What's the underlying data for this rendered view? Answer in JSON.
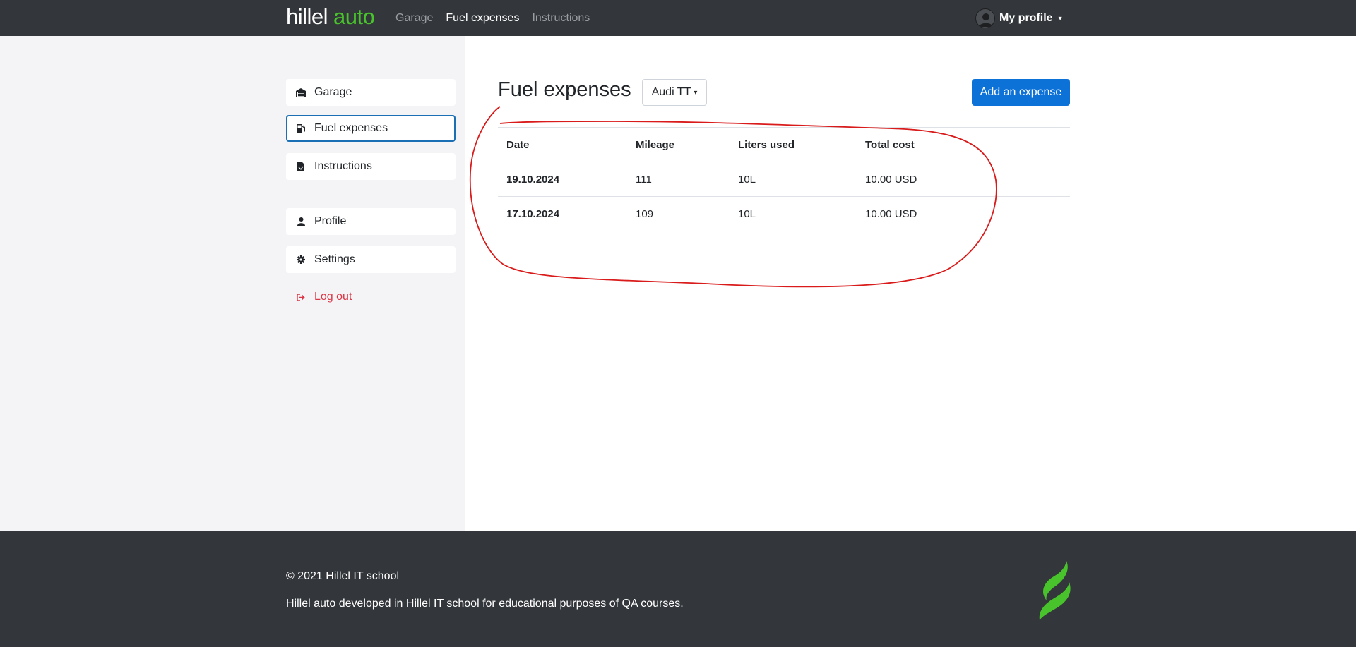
{
  "header": {
    "logo_primary": "hillel",
    "logo_secondary": "auto",
    "nav": [
      {
        "label": "Garage",
        "active": false
      },
      {
        "label": "Fuel expenses",
        "active": true
      },
      {
        "label": "Instructions",
        "active": false
      }
    ],
    "profile_label": "My profile"
  },
  "sidebar": {
    "items": [
      {
        "label": "Garage",
        "icon": "garage-icon"
      },
      {
        "label": "Fuel expenses",
        "icon": "fuel-pump-icon",
        "active": true
      },
      {
        "label": "Instructions",
        "icon": "document-icon"
      },
      {
        "label": "Profile",
        "icon": "user-icon"
      },
      {
        "label": "Settings",
        "icon": "gear-icon"
      },
      {
        "label": "Log out",
        "icon": "logout-icon"
      }
    ]
  },
  "main": {
    "title": "Fuel expenses",
    "car_select": "Audi TT",
    "add_button": "Add an expense",
    "table": {
      "headers": [
        "Date",
        "Mileage",
        "Liters used",
        "Total cost"
      ],
      "rows": [
        [
          "19.10.2024",
          "111",
          "10L",
          "10.00 USD"
        ],
        [
          "17.10.2024",
          "109",
          "10L",
          "10.00 USD"
        ]
      ]
    }
  },
  "footer": {
    "copyright": "© 2021 Hillel IT school",
    "description": "Hillel auto developed in Hillel IT school for educational purposes of QA courses."
  },
  "colors": {
    "header_bg": "#33363a",
    "brand_green": "#49c32c",
    "primary_blue": "#0d72d8",
    "annotation_red": "#d91b1b",
    "logout_red": "#dc3545"
  }
}
